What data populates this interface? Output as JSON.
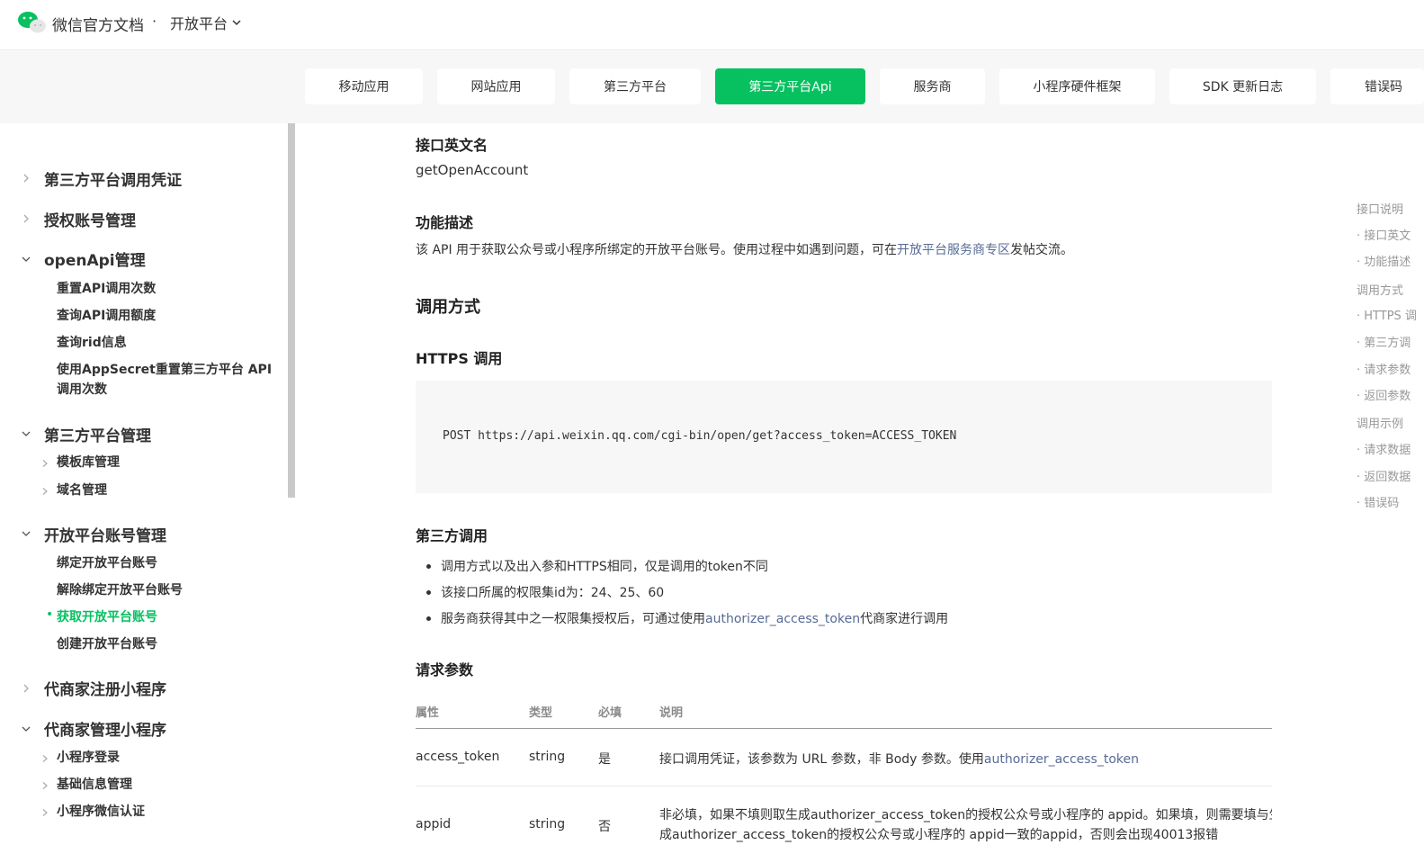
{
  "header": {
    "brand": "微信官方文档",
    "separator": "·",
    "platform": "开放平台"
  },
  "tabs": [
    {
      "label": "移动应用",
      "active": false
    },
    {
      "label": "网站应用",
      "active": false
    },
    {
      "label": "第三方平台",
      "active": false
    },
    {
      "label": "第三方平台Api",
      "active": true
    },
    {
      "label": "服务商",
      "active": false
    },
    {
      "label": "小程序硬件框架",
      "active": false
    },
    {
      "label": "SDK 更新日志",
      "active": false
    },
    {
      "label": "错误码",
      "active": false
    }
  ],
  "sidebar": {
    "groups": [
      {
        "label": "第三方平台调用凭证",
        "expanded": false
      },
      {
        "label": "授权账号管理",
        "expanded": false
      },
      {
        "label": "openApi管理",
        "expanded": true,
        "items": [
          "重置API调用次数",
          "查询API调用额度",
          "查询rid信息",
          "使用AppSecret重置第三方平台 API",
          "调用次数"
        ]
      },
      {
        "label": "第三方平台管理",
        "expanded": true,
        "items": [
          "模板库管理",
          "域名管理"
        ]
      },
      {
        "label": "开放平台账号管理",
        "expanded": true,
        "items": [
          "绑定开放平台账号",
          "解除绑定开放平台账号",
          "获取开放平台账号",
          "创建开放平台账号"
        ],
        "active_item": "获取开放平台账号"
      },
      {
        "label": "代商家注册小程序",
        "expanded": false
      },
      {
        "label": "代商家管理小程序",
        "expanded": true,
        "items": [
          "小程序登录",
          "基础信息管理",
          "小程序微信认证"
        ]
      }
    ]
  },
  "content": {
    "api_name_heading": "接口英文名",
    "api_name": "getOpenAccount",
    "desc_heading": "功能描述",
    "desc_text": "该 API 用于获取公众号或小程序所绑定的开放平台账号。使用过程中如遇到问题，可在",
    "desc_link": "开放平台服务商专区",
    "desc_tail": "发帖交流。",
    "call_heading": "调用方式",
    "https_heading": "HTTPS 调用",
    "code": "POST https://api.weixin.qq.com/cgi-bin/open/get?access_token=ACCESS_TOKEN",
    "third_heading": "第三方调用",
    "bullets": {
      "b1": "调用方式以及出入参和HTTPS相同，仅是调用的token不同",
      "b2": "该接口所属的权限集id为：24、25、60",
      "b3_pre": "服务商获得其中之一权限集授权后，可通过使用",
      "b3_link": "authorizer_access_token",
      "b3_post": "代商家进行调用"
    },
    "params_heading": "请求参数",
    "table": {
      "headers": [
        "属性",
        "类型",
        "必填",
        "说明"
      ],
      "row1": {
        "name": "access_token",
        "type": "string",
        "required": "是",
        "desc_pre": "接口调用凭证，该参数为 URL 参数，非 Body 参数。使用",
        "desc_link": "authorizer_access_token"
      },
      "row2": {
        "name": "appid",
        "type": "string",
        "required": "否",
        "desc_line1": "非必填，如果不填则取生成authorizer_access_token的授权公众号或小程序的 appid。如果填，则需要填与生",
        "desc_line2": "成authorizer_access_token的授权公众号或小程序的 appid一致的appid，否则会出现40013报错"
      }
    }
  },
  "toc": [
    "接口说明",
    "· 接口英文",
    "· 功能描述",
    "调用方式",
    "· HTTPS 调",
    "· 第三方调",
    "· 请求参数",
    "· 返回参数",
    "调用示例",
    "· 请求数据",
    "· 返回数据",
    "· 错误码"
  ],
  "colors": {
    "accent": "#07c160",
    "link": "#576b95"
  }
}
